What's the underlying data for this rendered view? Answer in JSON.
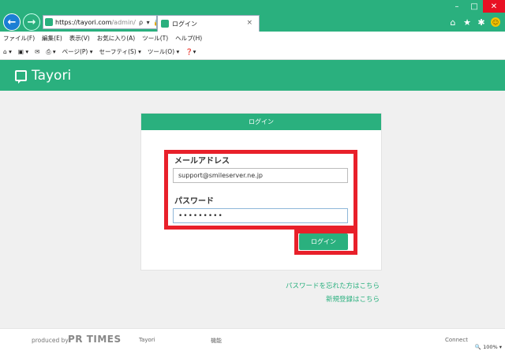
{
  "browser": {
    "address_host": "https://tayori.com",
    "address_path": "/admin/",
    "address_tools": "ρ ▾ 🔒 C",
    "tab_title": "ログイン",
    "tab_close": "×",
    "back_glyph": "←",
    "forward_glyph": "→",
    "window_minimize": "–",
    "window_maximize": "□",
    "window_close": "✕",
    "menu": [
      "ファイル(F)",
      "編集(E)",
      "表示(V)",
      "お気に入り(A)",
      "ツール(T)",
      "ヘルプ(H)"
    ],
    "commands": [
      "ページ(P) ▾",
      "セーフティ(S) ▾",
      "ツール(O) ▾"
    ]
  },
  "site": {
    "logo_text": "Tayori"
  },
  "login": {
    "header": "ログイン",
    "email_label": "メールアドレス",
    "email_value": "support@smileserver.ne.jp",
    "password_label": "パスワード",
    "password_value": "•••••••••",
    "submit_label": "ログイン",
    "forgot_password_link": "パスワードを忘れた方はこちら",
    "signup_link": "新規登録はこちら"
  },
  "footer": {
    "produced_by": "produced by",
    "prtimes": "PR TIMES",
    "tayori": "Tayori",
    "features": "機能",
    "connect": "Connect",
    "zoom": "🔍 100% ▾"
  },
  "colors": {
    "brand": "#2ab07e",
    "annotation": "#e8202a"
  }
}
